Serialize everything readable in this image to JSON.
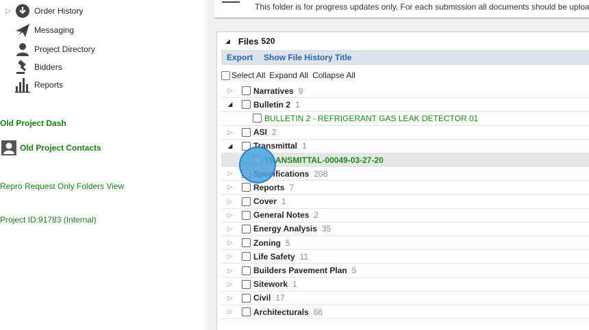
{
  "sidebar": {
    "nav": [
      {
        "label": "Order History",
        "icon": "download-circle-icon",
        "caret": "▷"
      },
      {
        "label": "Messaging",
        "icon": "paper-plane-icon"
      },
      {
        "label": "Project Directory",
        "icon": "person-icon"
      },
      {
        "label": "Bidders",
        "icon": "gavel-icon"
      },
      {
        "label": "Reports",
        "icon": "bar-chart-icon"
      }
    ],
    "old_project_dash": "Old Project Dash",
    "old_project_contacts": "Old Project Contacts",
    "repro_request": "Repro Request Only Folders View",
    "project_id": "Project ID:91783 (Internal)"
  },
  "notice": {
    "text": "This folder is for progress updates only. For each submission all documents should be uploa"
  },
  "files": {
    "title": "Files",
    "count": "520",
    "toolbar": {
      "export": "Export",
      "history": "Show File History Title"
    },
    "actions": {
      "select_all": "Select All",
      "expand_all": "Expand All",
      "collapse_all": "Collapse All"
    },
    "rows": [
      {
        "name": "Narratives",
        "count": "9",
        "expanded": false
      },
      {
        "name": "Bulletin 2",
        "count": "1",
        "expanded": true
      },
      {
        "name": "BULLETIN 2 - REFRIGERANT GAS LEAK DETECTOR 01",
        "count": "",
        "child": true
      },
      {
        "name": "ASI",
        "count": "2",
        "expanded": false
      },
      {
        "name": "Transmittal",
        "count": "1",
        "expanded": true
      },
      {
        "name": "TRANSMITTAL-00049-03-27-20",
        "count": "",
        "child": true,
        "highlight": true
      },
      {
        "name": "Specifications",
        "count": "208",
        "expanded": false
      },
      {
        "name": "Reports",
        "count": "7",
        "expanded": false
      },
      {
        "name": "Cover",
        "count": "1",
        "expanded": false
      },
      {
        "name": "General Notes",
        "count": "2",
        "expanded": false
      },
      {
        "name": "Energy Analysis",
        "count": "35",
        "expanded": false
      },
      {
        "name": "Zoning",
        "count": "5",
        "expanded": false
      },
      {
        "name": "Life Safety",
        "count": "11",
        "expanded": false
      },
      {
        "name": "Builders Pavement Plan",
        "count": "5",
        "expanded": false
      },
      {
        "name": "Sitework",
        "count": "1",
        "expanded": false
      },
      {
        "name": "Civil",
        "count": "17",
        "expanded": false
      },
      {
        "name": "Architecturals",
        "count": "66",
        "expanded": false
      }
    ]
  },
  "colors": {
    "link_green": "#1a7a1a",
    "link_blue": "#2364a8",
    "click_indicator": "#46a0e1"
  }
}
